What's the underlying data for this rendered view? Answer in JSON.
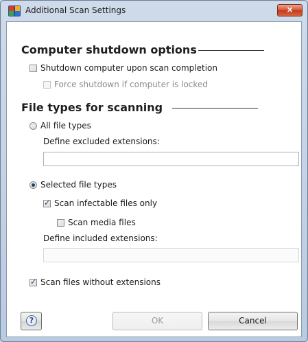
{
  "window": {
    "title": "Additional Scan Settings",
    "close_label": "×"
  },
  "shutdown": {
    "section_title": "Computer shutdown options",
    "shutdown_label": "Shutdown computer upon scan completion",
    "shutdown_checked": false,
    "force_label": "Force shutdown if computer is locked",
    "force_checked": false,
    "force_enabled": false
  },
  "file_types": {
    "section_title": "File types for scanning",
    "all_label": "All file types",
    "all_selected": false,
    "excluded_label": "Define excluded extensions:",
    "excluded_value": "",
    "selected_label": "Selected file types",
    "selected_selected": true,
    "infectable_label": "Scan infectable files only",
    "infectable_checked": true,
    "media_label": "Scan media files",
    "media_checked": false,
    "included_label": "Define included extensions:",
    "included_value": "",
    "no_ext_label": "Scan files without extensions",
    "no_ext_checked": true
  },
  "footer": {
    "help_icon": "question-icon",
    "help_glyph": "?",
    "ok_label": "OK",
    "cancel_label": "Cancel"
  },
  "colors": {
    "close_button": "#c23a1d",
    "checkmark": "#1e3c6e",
    "window_frame": "#b9cbe0"
  }
}
